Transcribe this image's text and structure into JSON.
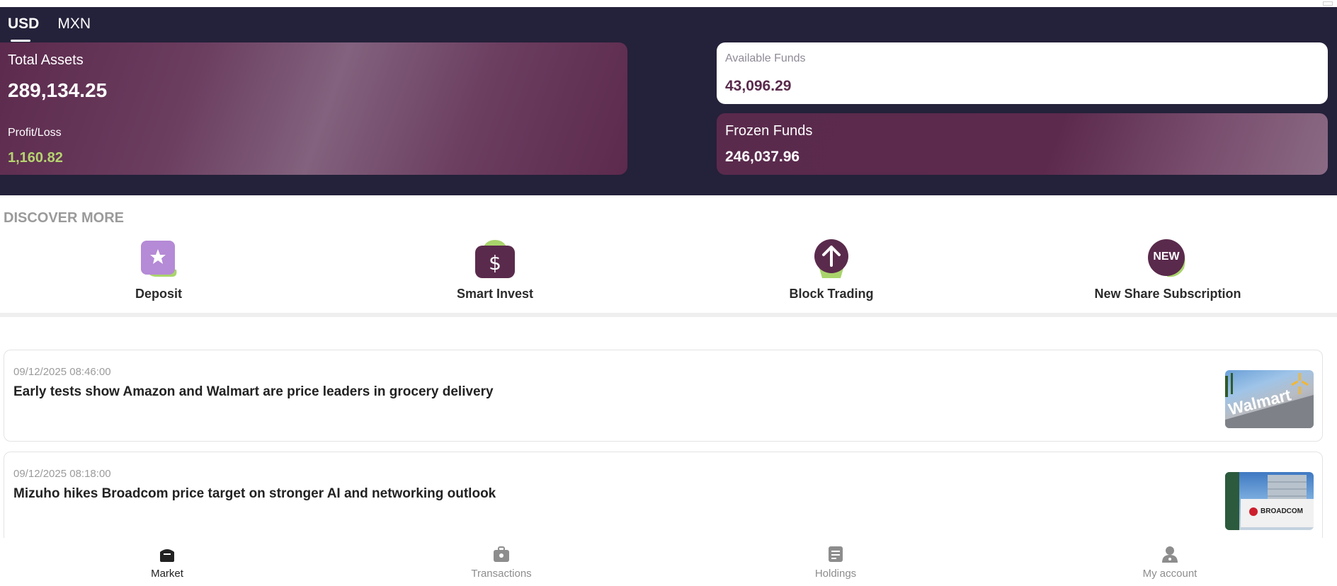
{
  "currency": {
    "tabs": [
      "USD",
      "MXN"
    ],
    "active": "USD"
  },
  "assets": {
    "total_label": "Total Assets",
    "total_value": "289,134.25",
    "pl_label": "Profit/Loss",
    "pl_value": "1,160.82"
  },
  "available": {
    "label": "Available Funds",
    "value": "43,096.29"
  },
  "frozen": {
    "label": "Frozen Funds",
    "value": "246,037.96"
  },
  "discover": {
    "title": "DISCOVER MORE",
    "items": [
      {
        "label": "Deposit",
        "icon": "star-card-icon"
      },
      {
        "label": "Smart Invest",
        "icon": "dollar-wallet-icon"
      },
      {
        "label": "Block Trading",
        "icon": "up-arrow-circle-icon"
      },
      {
        "label": "New Share Subscription",
        "icon": "new-badge-icon",
        "badge": "NEW"
      }
    ]
  },
  "news": [
    {
      "time": "09/12/2025 08:46:00",
      "headline": "Early tests show Amazon and Walmart are price leaders in grocery delivery",
      "thumb_text": "Walmart"
    },
    {
      "time": "09/12/2025 08:18:00",
      "headline": "Mizuho hikes Broadcom price target on stronger AI and networking outlook",
      "thumb_text": "BROADCOM"
    }
  ],
  "nav": {
    "items": [
      {
        "label": "Market",
        "icon": "market-icon"
      },
      {
        "label": "Transactions",
        "icon": "briefcase-icon"
      },
      {
        "label": "Holdings",
        "icon": "document-icon"
      },
      {
        "label": "My account",
        "icon": "user-icon"
      }
    ],
    "active": "Market"
  },
  "colors": {
    "header_bg": "#24213a",
    "accent": "#5a2a4c",
    "profit": "#b5d36f",
    "icon_green": "#a9d46b",
    "icon_lavender": "#b58ad6"
  }
}
